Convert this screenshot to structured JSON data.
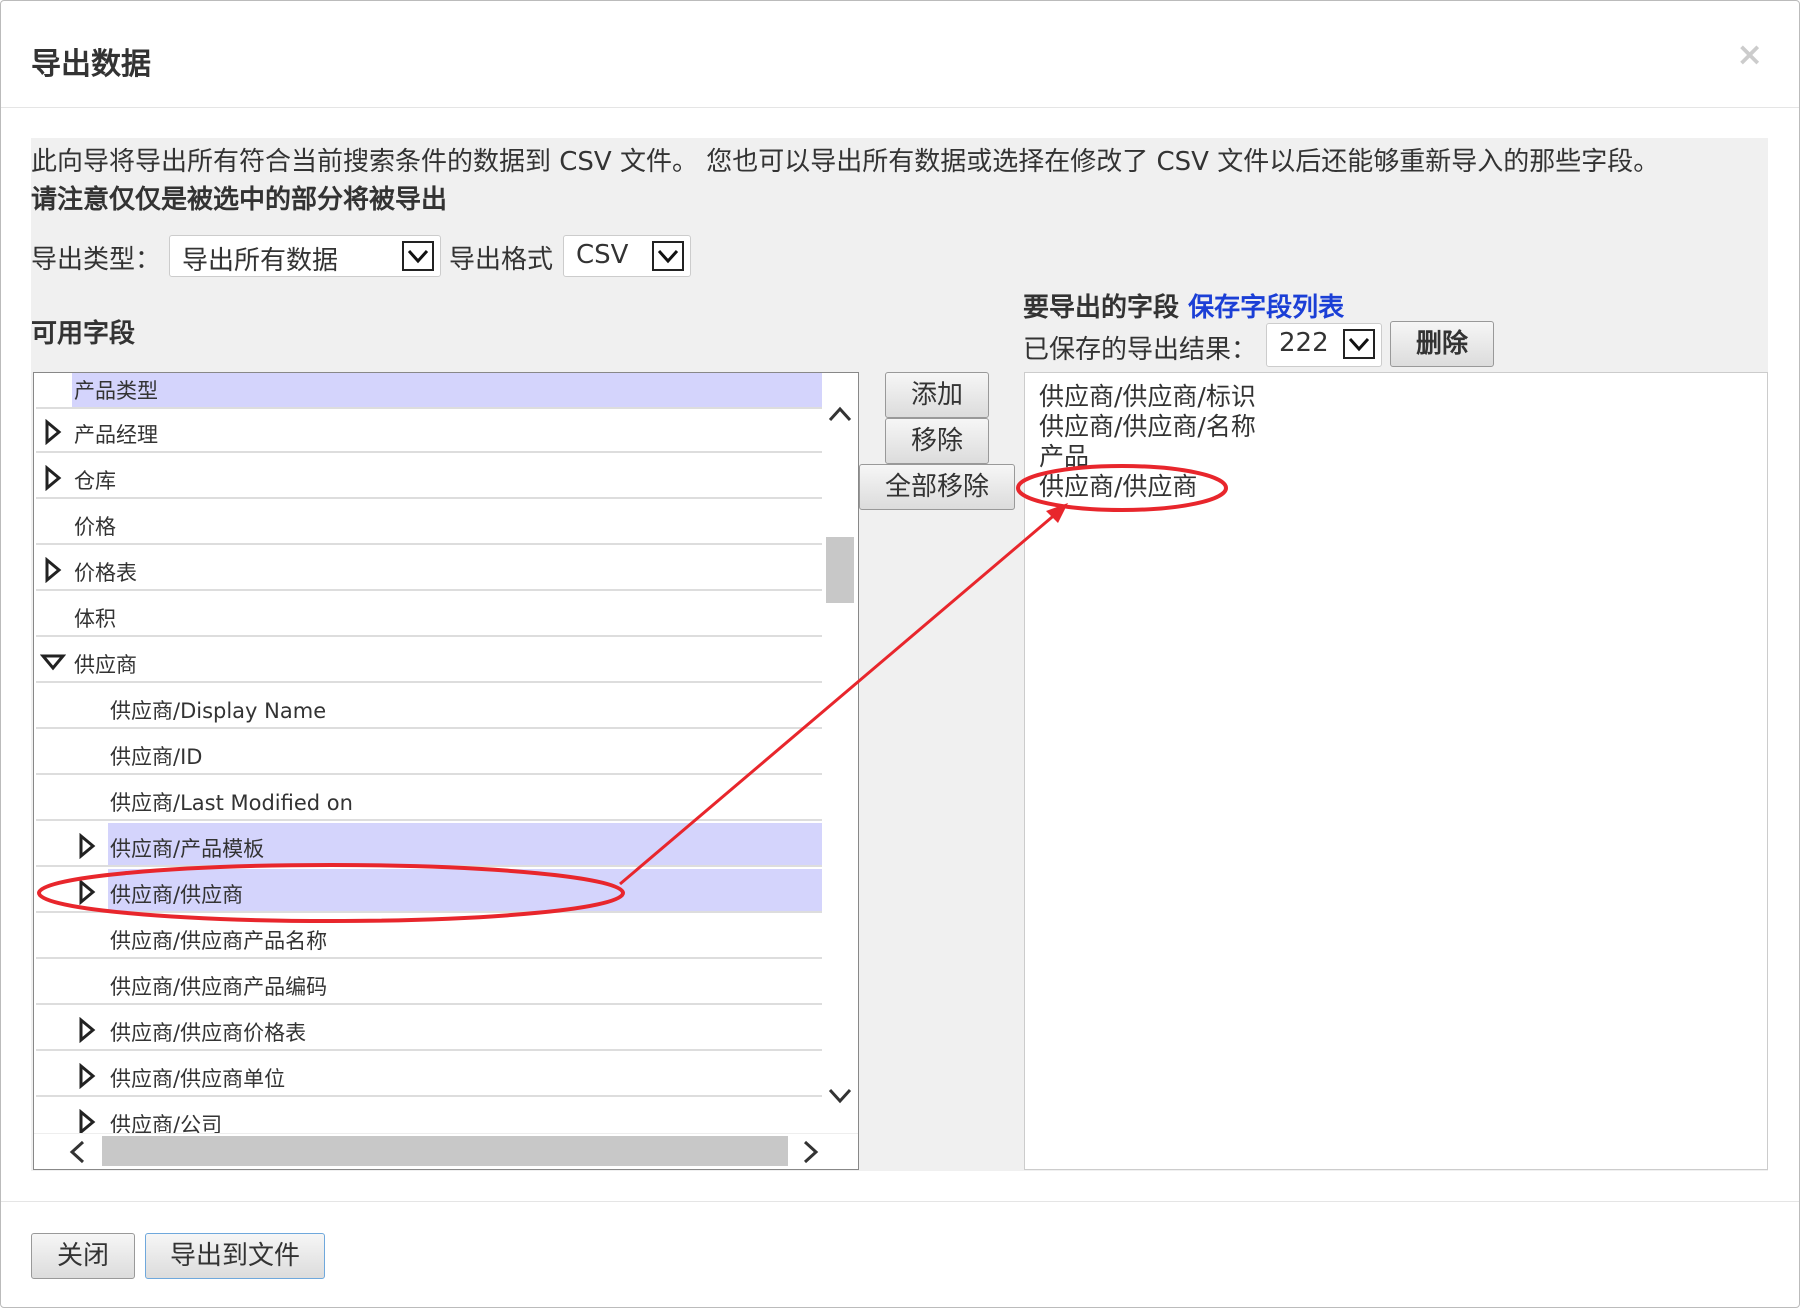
{
  "dialog": {
    "title": "导出数据",
    "close_symbol": "×",
    "description": "此向导将导出所有符合当前搜索条件的数据到 CSV 文件。 您也可以导出所有数据或选择在修改了 CSV 文件以后还能够重新导入的那些字段。",
    "note": "请注意仅仅是被选中的部分将被导出"
  },
  "export_type": {
    "label": "导出类型：",
    "value": "导出所有数据"
  },
  "export_format": {
    "label": "导出格式",
    "value": "CSV"
  },
  "available_fields": {
    "heading": "可用字段",
    "items": [
      {
        "label": "产品类型",
        "expandable": false,
        "highlighted": true
      },
      {
        "label": "产品经理",
        "expandable": true
      },
      {
        "label": "仓库",
        "expandable": true
      },
      {
        "label": "价格",
        "expandable": false
      },
      {
        "label": "价格表",
        "expandable": true
      },
      {
        "label": "体积",
        "expandable": false
      },
      {
        "label": "供应商",
        "expandable": true,
        "expanded": true
      },
      {
        "label": "供应商/Display Name",
        "expandable": false
      },
      {
        "label": "供应商/ID",
        "expandable": false
      },
      {
        "label": "供应商/Last Modified on",
        "expandable": false
      },
      {
        "label": "供应商/产品模板",
        "expandable": true,
        "highlighted": true
      },
      {
        "label": "供应商/供应商",
        "expandable": true,
        "highlighted": true
      },
      {
        "label": "供应商/供应商产品名称",
        "expandable": false
      },
      {
        "label": "供应商/供应商产品编码",
        "expandable": false
      },
      {
        "label": "供应商/供应商价格表",
        "expandable": true
      },
      {
        "label": "供应商/供应商单位",
        "expandable": true
      },
      {
        "label": "供应商/公司",
        "expandable": true
      }
    ]
  },
  "middle_buttons": {
    "add": "添加",
    "remove": "移除",
    "remove_all": "全部移除"
  },
  "export_fields": {
    "heading": "要导出的字段",
    "save_link": "保存字段列表",
    "saved_label": "已保存的导出结果：",
    "saved_value": "222",
    "delete_button": "删除",
    "items": [
      "供应商/供应商/标识",
      "供应商/供应商/名称",
      "产品",
      "供应商/供应商"
    ]
  },
  "footer": {
    "close_button": "关闭",
    "export_button": "导出到文件"
  },
  "colors": {
    "highlight": "#d4d4fc",
    "annotation": "#e8262c",
    "link": "#1b3fd6"
  }
}
